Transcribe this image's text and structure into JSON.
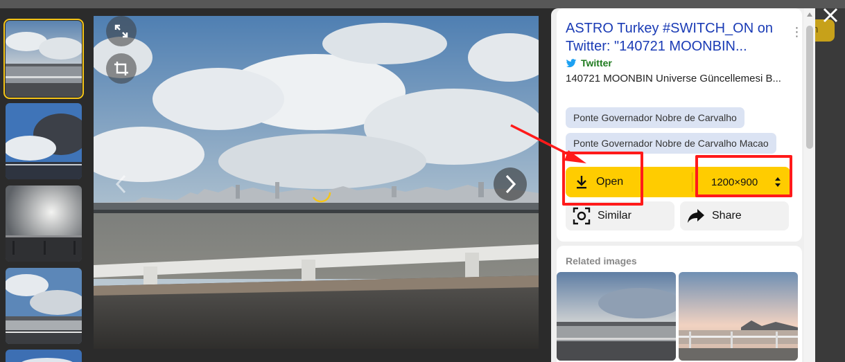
{
  "result": {
    "title": "ASTRO Turkey #SWITCH_ON on Twitter: \"140721 MOONBIN...",
    "source": "Twitter",
    "description": "140721 MOONBIN Universe Güncellemesi B..."
  },
  "tags": [
    "Ponte Governador Nobre de Carvalho",
    "Ponte Governador Nobre de Carvalho Macao"
  ],
  "actions": {
    "open_label": "Open",
    "size_label": "1200×900",
    "similar_label": "Similar",
    "share_label": "Share"
  },
  "related": {
    "title": "Related images"
  },
  "backdrop": {
    "button_fragment": "n"
  },
  "colors": {
    "accent": "#ffcc00",
    "title_link": "#1a3bb5",
    "source_green": "#1e7a1e",
    "annotation_red": "#ff1a1a",
    "active_thumb": "#f5c518"
  },
  "icons": {
    "expand": "expand-icon",
    "crop": "crop-icon",
    "prev": "chevron-left-icon",
    "next": "chevron-right-icon",
    "download": "download-icon",
    "sort": "sort-icon",
    "similar": "camera-lens-icon",
    "share": "share-arrow-icon",
    "close": "close-icon",
    "more": "more-vertical-icon"
  }
}
